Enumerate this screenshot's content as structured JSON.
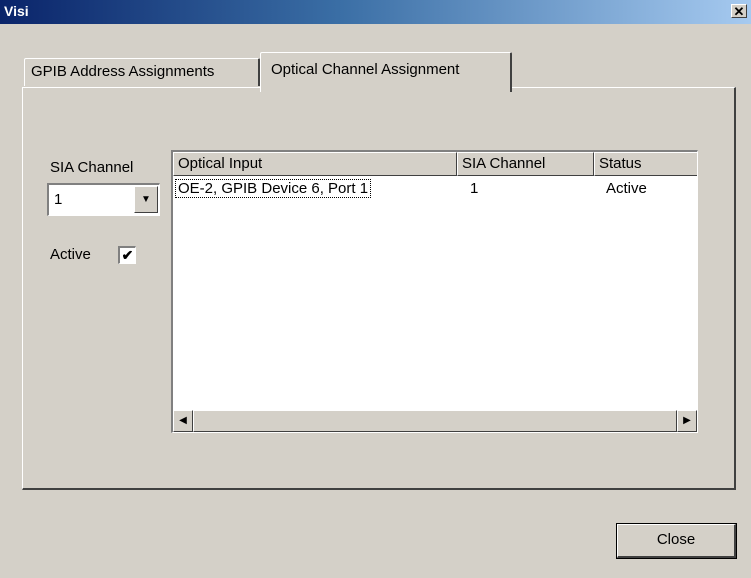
{
  "window": {
    "title": "Visi",
    "close_glyph": "✕"
  },
  "tabs": [
    {
      "label": "GPIB Address Assignments",
      "selected": false
    },
    {
      "label": "Optical Channel Assignment",
      "selected": true
    }
  ],
  "form": {
    "sia_channel_label": "SIA Channel",
    "sia_channel_value": "1",
    "active_label": "Active",
    "active_checked": true,
    "check_glyph": "✔"
  },
  "list": {
    "columns": [
      "Optical Input",
      "SIA Channel",
      "Status"
    ],
    "rows": [
      {
        "optical_input": "OE-2, GPIB Device 6, Port 1",
        "sia_channel": "1",
        "status": "Active"
      }
    ]
  },
  "buttons": {
    "close_label": "Close"
  },
  "icons": {
    "dropdown": "chevron-down-icon",
    "scroll_left": "arrow-left-icon",
    "scroll_right": "arrow-right-icon"
  },
  "colors": {
    "title_start": "#0a246a",
    "title_end": "#a6caf0",
    "face": "#d4d0c8"
  }
}
